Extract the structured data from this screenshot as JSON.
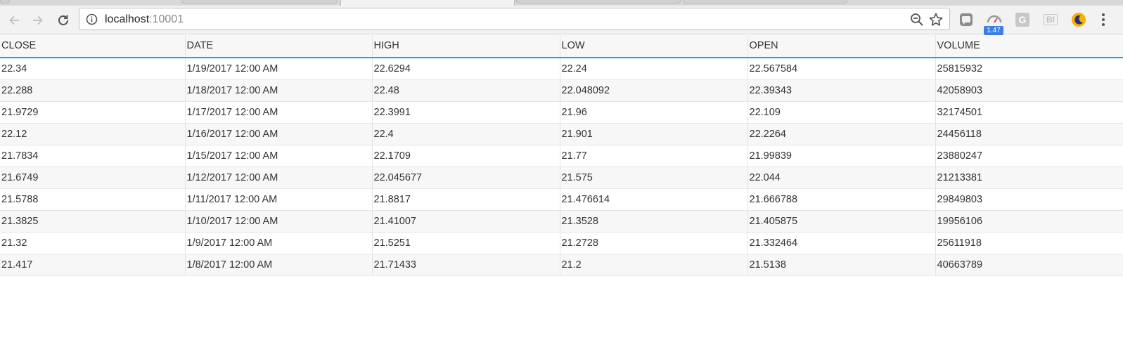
{
  "browser": {
    "url_host": "localhost",
    "url_port": ":10001",
    "extension_badge": "1.47",
    "extension_g_label": "G",
    "extension_bi_label": "BI",
    "icons": {
      "back": "arrow-left-icon",
      "forward": "arrow-right-icon",
      "reload": "reload-icon",
      "info": "info-icon",
      "zoom": "zoom-out-icon",
      "bookmark": "star-icon",
      "menu": "three-dots-icon"
    }
  },
  "table": {
    "columns": [
      "CLOSE",
      "DATE",
      "HIGH",
      "LOW",
      "OPEN",
      "VOLUME"
    ],
    "rows": [
      [
        "22.34",
        "1/19/2017 12:00 AM",
        "22.6294",
        "22.24",
        "22.567584",
        "25815932"
      ],
      [
        "22.288",
        "1/18/2017 12:00 AM",
        "22.48",
        "22.048092",
        "22.39343",
        "42058903"
      ],
      [
        "21.9729",
        "1/17/2017 12:00 AM",
        "22.3991",
        "21.96",
        "22.109",
        "32174501"
      ],
      [
        "22.12",
        "1/16/2017 12:00 AM",
        "22.4",
        "21.901",
        "22.2264",
        "24456118"
      ],
      [
        "21.7834",
        "1/15/2017 12:00 AM",
        "22.1709",
        "21.77",
        "21.99839",
        "23880247"
      ],
      [
        "21.6749",
        "1/12/2017 12:00 AM",
        "22.045677",
        "21.575",
        "22.044",
        "21213381"
      ],
      [
        "21.5788",
        "1/11/2017 12:00 AM",
        "21.8817",
        "21.476614",
        "21.666788",
        "29849803"
      ],
      [
        "21.3825",
        "1/10/2017 12:00 AM",
        "21.41007",
        "21.3528",
        "21.405875",
        "19956106"
      ],
      [
        "21.32",
        "1/9/2017 12:00 AM",
        "21.5251",
        "21.2728",
        "21.332464",
        "25611918"
      ],
      [
        "21.417",
        "1/8/2017 12:00 AM",
        "21.71433",
        "21.2",
        "21.5138",
        "40663789"
      ]
    ]
  },
  "colors": {
    "header_underline": "#2c9ce0",
    "row_alt": "#f7f7f7",
    "badge": "#3d7fe0"
  }
}
